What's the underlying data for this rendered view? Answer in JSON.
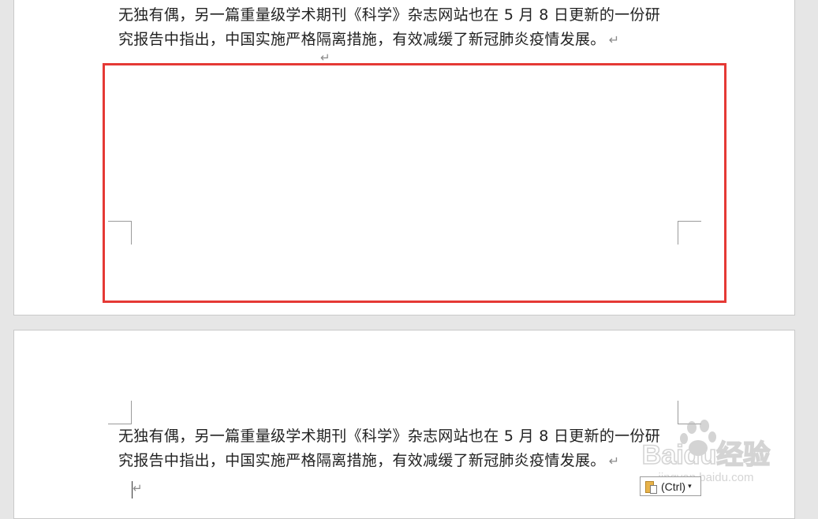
{
  "document": {
    "page1": {
      "paragraph": {
        "line1": "无独有偶，另一篇重量级学术期刊《科学》杂志网站也在 5 月 8 日更新的一份研",
        "line2": "究报告中指出，中国实施严格隔离措施，有效减缓了新冠肺炎疫情发展。"
      },
      "paragraph_mark": "↵",
      "empty_paragraph_mark": "↵"
    },
    "page2": {
      "paragraph": {
        "line1": "无独有偶，另一篇重量级学术期刊《科学》杂志网站也在 5 月 8 日更新的一份研",
        "line2": "究报告中指出，中国实施严格隔离措施，有效减缓了新冠肺炎疫情发展。"
      },
      "paragraph_mark": "↵",
      "cursor_paragraph_mark": "↵"
    }
  },
  "paste_options": {
    "label": "(Ctrl)",
    "arrow": "▾",
    "icon": "clipboard-paste-icon"
  },
  "watermark": {
    "brand": "Baidu经验",
    "url": "jingyan.baidu.com"
  },
  "colors": {
    "highlight_border": "#e53935",
    "canvas_background": "#e6e6e6",
    "page_background": "#ffffff"
  }
}
